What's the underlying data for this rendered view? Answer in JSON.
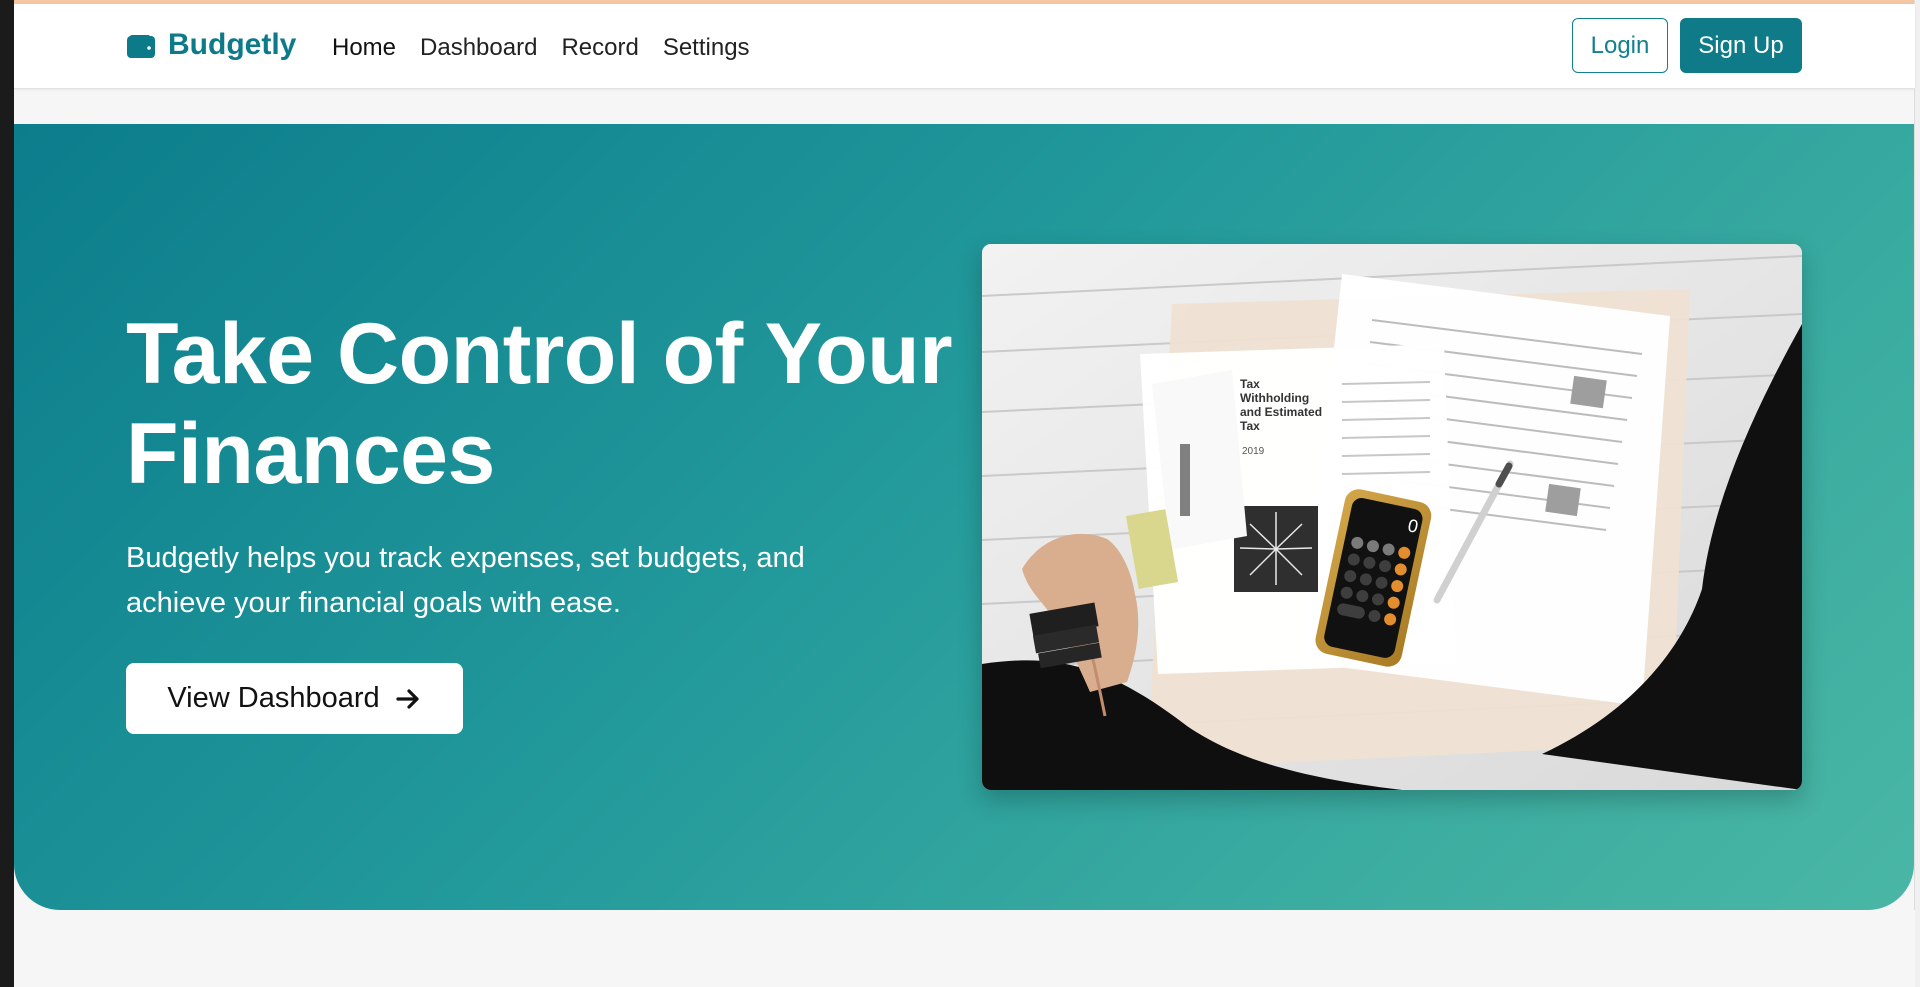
{
  "navbar": {
    "brand": "Budgetly",
    "links": [
      "Home",
      "Dashboard",
      "Record",
      "Settings"
    ],
    "auth": {
      "login": "Login",
      "signup": "Sign Up"
    }
  },
  "hero": {
    "title": "Take Control of Your Finances",
    "description": "Budgetly helps you track expenses, set budgets, and achieve your financial goals with ease.",
    "cta": "View Dashboard",
    "image": {
      "document_title": "Tax Withholding and Estimated Tax",
      "year": "2019"
    }
  },
  "colors": {
    "brand": "#0d7a89",
    "button": "#0f7b89",
    "hero_start": "#0b7d8c",
    "hero_end": "#4ab7a5",
    "background": "#f6f6f6"
  },
  "icons": {
    "brand": "wallet-icon",
    "cta": "arrow-right-icon"
  }
}
